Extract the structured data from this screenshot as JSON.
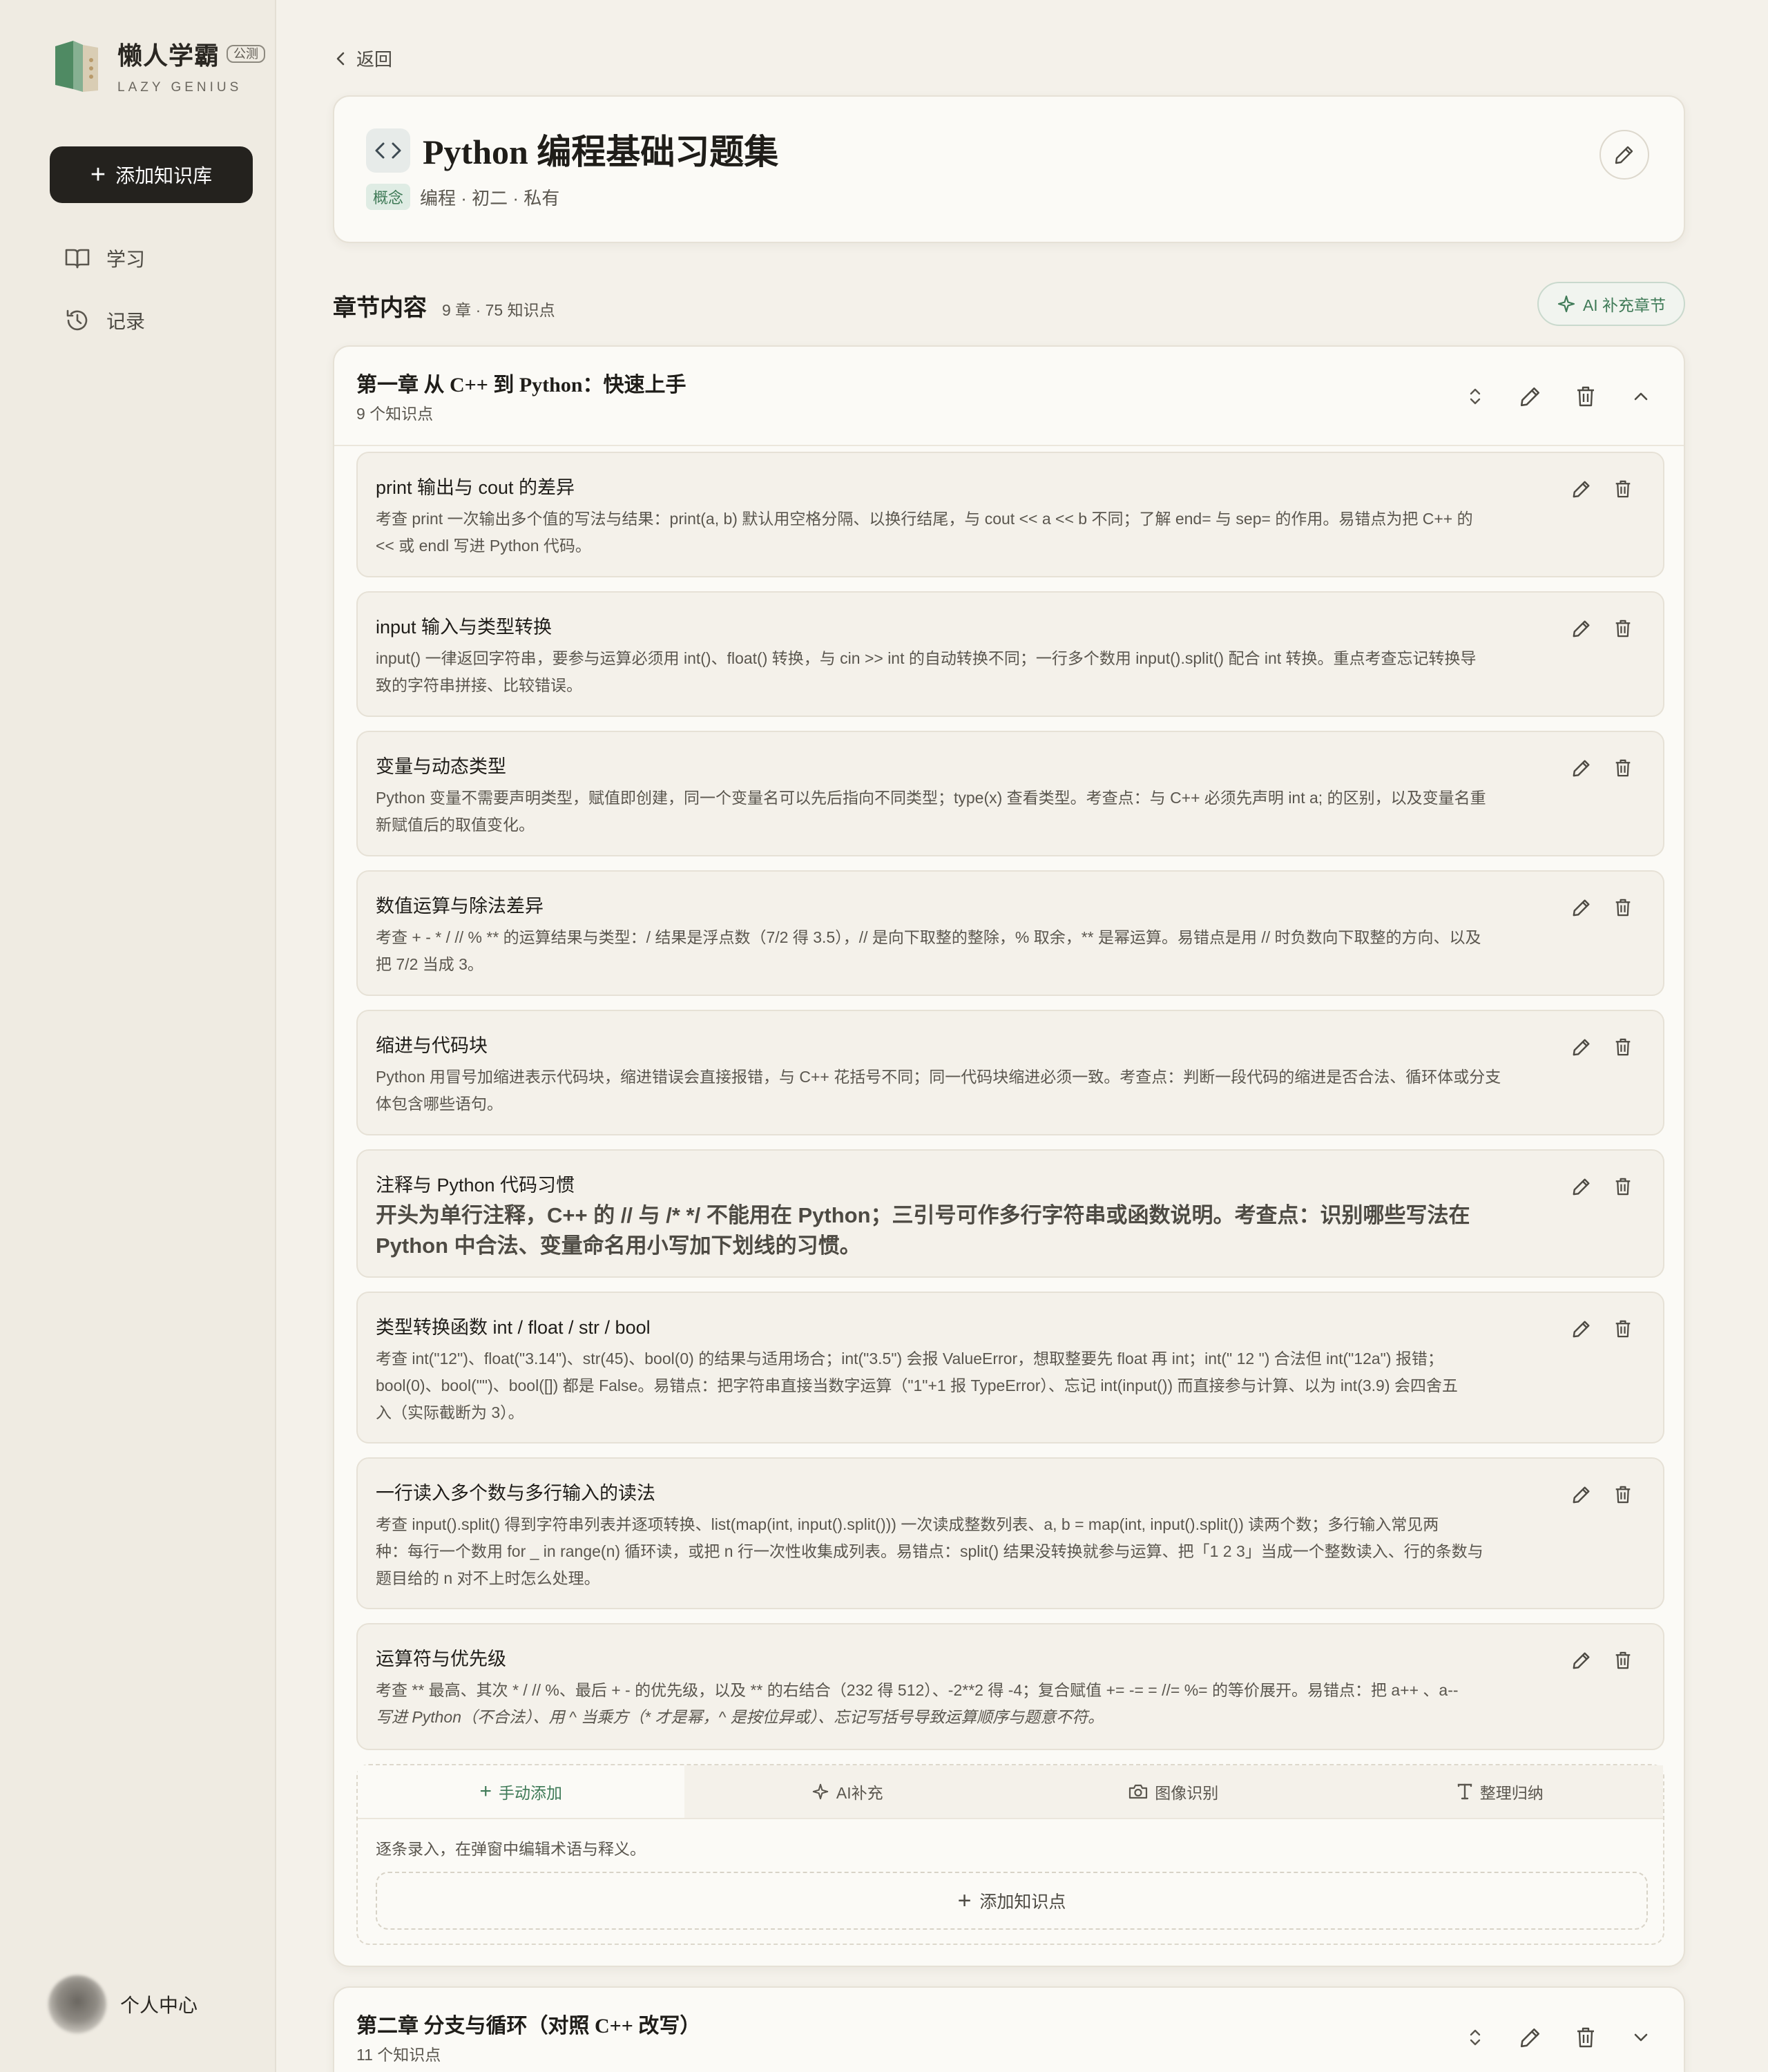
{
  "brand": {
    "title": "懒人学霸",
    "badge": "公测",
    "subtitle": "LAZY GENIUS"
  },
  "sidebar": {
    "add_button": "添加知识库",
    "items": [
      {
        "label": "学习",
        "icon": "book-icon"
      },
      {
        "label": "记录",
        "icon": "history-icon"
      }
    ],
    "profile_label": "个人中心"
  },
  "back_label": "返回",
  "header": {
    "title": "Python 编程基础习题集",
    "tag": "概念",
    "meta": "编程 · 初二 · 私有"
  },
  "section": {
    "title": "章节内容",
    "stats": "9 章 · 75 知识点",
    "ai_button": "AI 补充章节"
  },
  "chapters": [
    {
      "title": "第一章 从 C++ 到 Python：快速上手",
      "count": "9 个知识点",
      "items": [
        {
          "title": "print 输出与 cout 的差异",
          "desc_lines": [
            "考查 print 一次输出多个值的写法与结果：print(a, b) 默认用空格分隔、以换行结尾，与 cout << a << b 不同；了解 end= 与 sep= 的作用。易错点为把 C++ 的",
            "<< 或 endl 写进 Python 代码。"
          ]
        },
        {
          "title": "input 输入与类型转换",
          "desc_lines": [
            "input() 一律返回字符串，要参与运算必须用 int()、float() 转换，与 cin >> int 的自动转换不同；一行多个数用 input().split() 配合 int 转换。重点考查忘记转换导",
            "致的字符串拼接、比较错误。"
          ]
        },
        {
          "title": "变量与动态类型",
          "desc_lines": [
            "Python 变量不需要声明类型，赋值即创建，同一个变量名可以先后指向不同类型；type(x) 查看类型。考查点：与 C++ 必须先声明 int a; 的区别，以及变量名重",
            "新赋值后的取值变化。"
          ]
        },
        {
          "title": "数值运算与除法差异",
          "desc_lines": [
            "考查 + - * / // % ** 的运算结果与类型：/ 结果是浮点数（7/2 得 3.5），// 是向下取整的整除，% 取余，** 是幂运算。易错点是用 // 时负数向下取整的方向、以及",
            "把 7/2 当成 3。"
          ]
        },
        {
          "title": "缩进与代码块",
          "desc_lines": [
            "Python 用冒号加缩进表示代码块，缩进错误会直接报错，与 C++ 花括号不同；同一代码块缩进必须一致。考查点：判断一段代码的缩进是否合法、循环体或分支",
            "体包含哪些语句。"
          ]
        },
        {
          "title": "注释与 Python 代码习惯",
          "desc_lines": [
            "开头为单行注释，C++ 的 // 与 /* */ 不能用在 Python；三引号可作多行字符串或函数说明。考查点：识别哪些写法在",
            "Python 中合法、变量命名用小写加下划线的习惯。"
          ]
        },
        {
          "title": "类型转换函数 int / float / str / bool",
          "desc_lines": [
            "考查 int(\"12\")、float(\"3.14\")、str(45)、bool(0) 的结果与适用场合；int(\"3.5\") 会报 ValueError，想取整要先 float 再 int；int(\" 12 \") 合法但 int(\"12a\") 报错；",
            "bool(0)、bool(\"\")、bool([]) 都是 False。易错点：把字符串直接当数字运算（\"1\"+1 报 TypeError）、忘记 int(input()) 而直接参与计算、以为 int(3.9) 会四舍五",
            "入（实际截断为 3）。"
          ]
        },
        {
          "title": "一行读入多个数与多行输入的读法",
          "desc_lines": [
            "考查 input().split() 得到字符串列表并逐项转换、list(map(int, input().split())) 一次读成整数列表、a, b = map(int, input().split()) 读两个数；多行输入常见两",
            "种：每行一个数用 for _ in range(n) 循环读，或把 n 行一次性收集成列表。易错点：split() 结果没转换就参与运算、把「1 2 3」当成一个整数读入、行的条数与",
            "题目给的 n 对不上时怎么处理。"
          ]
        },
        {
          "title": "运算符与优先级",
          "desc_lines": [
            "考查 ** 最高、其次 * / // %、最后 + - 的优先级，以及 ** 的右结合（2",
            "32 得 512）、-2**2 得 -4；复合赋值 += -= = //= %= 的等价展开。易错点：把 a++ 、a--",
            "写进 Python（不合法）、用 ^ 当乘方（* 才是幂，^ 是按位异或）、忘记写括号导致运算顺序与题意不符。"
          ]
        }
      ],
      "add_panel": {
        "tabs": [
          {
            "label": "手动添加",
            "icon": "plus-icon"
          },
          {
            "label": "AI补充",
            "icon": "sparkle-icon"
          },
          {
            "label": "图像识别",
            "icon": "camera-icon"
          },
          {
            "label": "整理归纳",
            "icon": "text-icon"
          }
        ],
        "hint": "逐条录入，在弹窗中编辑术语与释义。",
        "add_button": "添加知识点"
      }
    },
    {
      "title": "第二章 分支与循环（对照 C++ 改写）",
      "count": "11 个知识点"
    }
  ],
  "colors": {
    "accent": "#3f7a57",
    "background": "#f4f1ea",
    "dark_button": "#24221e"
  }
}
